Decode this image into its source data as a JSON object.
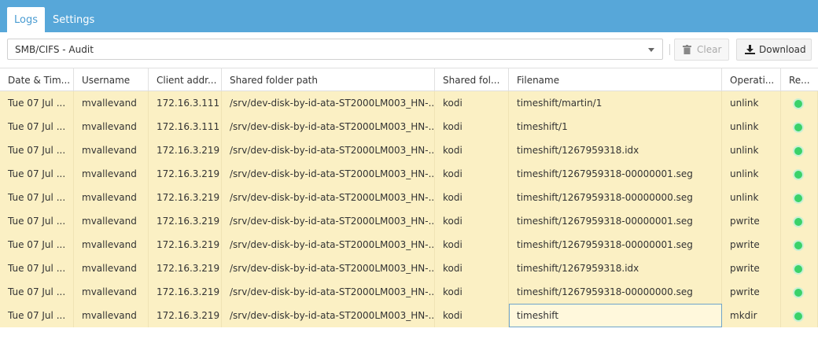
{
  "tabs": [
    {
      "label": "Logs"
    },
    {
      "label": "Settings"
    }
  ],
  "toolbar": {
    "select_value": "SMB/CIFS - Audit",
    "clear_label": "Clear",
    "download_label": "Download"
  },
  "columns": [
    "Date & Tim...",
    "Username",
    "Client addr...",
    "Shared folder path",
    "Shared fol...",
    "Filename",
    "Operati...",
    "Re..."
  ],
  "rows": [
    {
      "date": "Tue 07 Jul ...",
      "user": "mvallevand",
      "client": "172.16.3.111",
      "path": "/srv/dev-disk-by-id-ata-ST2000LM003_HN-...",
      "share": "kodi",
      "file": "timeshift/martin/1",
      "op": "unlink",
      "result": "ok"
    },
    {
      "date": "Tue 07 Jul ...",
      "user": "mvallevand",
      "client": "172.16.3.111",
      "path": "/srv/dev-disk-by-id-ata-ST2000LM003_HN-...",
      "share": "kodi",
      "file": "timeshift/1",
      "op": "unlink",
      "result": "ok"
    },
    {
      "date": "Tue 07 Jul ...",
      "user": "mvallevand",
      "client": "172.16.3.219",
      "path": "/srv/dev-disk-by-id-ata-ST2000LM003_HN-...",
      "share": "kodi",
      "file": "timeshift/1267959318.idx",
      "op": "unlink",
      "result": "ok"
    },
    {
      "date": "Tue 07 Jul ...",
      "user": "mvallevand",
      "client": "172.16.3.219",
      "path": "/srv/dev-disk-by-id-ata-ST2000LM003_HN-...",
      "share": "kodi",
      "file": "timeshift/1267959318-00000001.seg",
      "op": "unlink",
      "result": "ok"
    },
    {
      "date": "Tue 07 Jul ...",
      "user": "mvallevand",
      "client": "172.16.3.219",
      "path": "/srv/dev-disk-by-id-ata-ST2000LM003_HN-...",
      "share": "kodi",
      "file": "timeshift/1267959318-00000000.seg",
      "op": "unlink",
      "result": "ok"
    },
    {
      "date": "Tue 07 Jul ...",
      "user": "mvallevand",
      "client": "172.16.3.219",
      "path": "/srv/dev-disk-by-id-ata-ST2000LM003_HN-...",
      "share": "kodi",
      "file": "timeshift/1267959318-00000001.seg",
      "op": "pwrite",
      "result": "ok"
    },
    {
      "date": "Tue 07 Jul ...",
      "user": "mvallevand",
      "client": "172.16.3.219",
      "path": "/srv/dev-disk-by-id-ata-ST2000LM003_HN-...",
      "share": "kodi",
      "file": "timeshift/1267959318-00000001.seg",
      "op": "pwrite",
      "result": "ok"
    },
    {
      "date": "Tue 07 Jul ...",
      "user": "mvallevand",
      "client": "172.16.3.219",
      "path": "/srv/dev-disk-by-id-ata-ST2000LM003_HN-...",
      "share": "kodi",
      "file": "timeshift/1267959318.idx",
      "op": "pwrite",
      "result": "ok"
    },
    {
      "date": "Tue 07 Jul ...",
      "user": "mvallevand",
      "client": "172.16.3.219",
      "path": "/srv/dev-disk-by-id-ata-ST2000LM003_HN-...",
      "share": "kodi",
      "file": "timeshift/1267959318-00000000.seg",
      "op": "pwrite",
      "result": "ok"
    },
    {
      "date": "Tue 07 Jul ...",
      "user": "mvallevand",
      "client": "172.16.3.219",
      "path": "/srv/dev-disk-by-id-ata-ST2000LM003_HN-...",
      "share": "kodi",
      "file": "timeshift",
      "op": "mkdir",
      "result": "ok"
    }
  ],
  "colors": {
    "tabbar": "#57a7d9",
    "row_bg": "#fbf0c4",
    "status_ok": "#3ad26a"
  }
}
